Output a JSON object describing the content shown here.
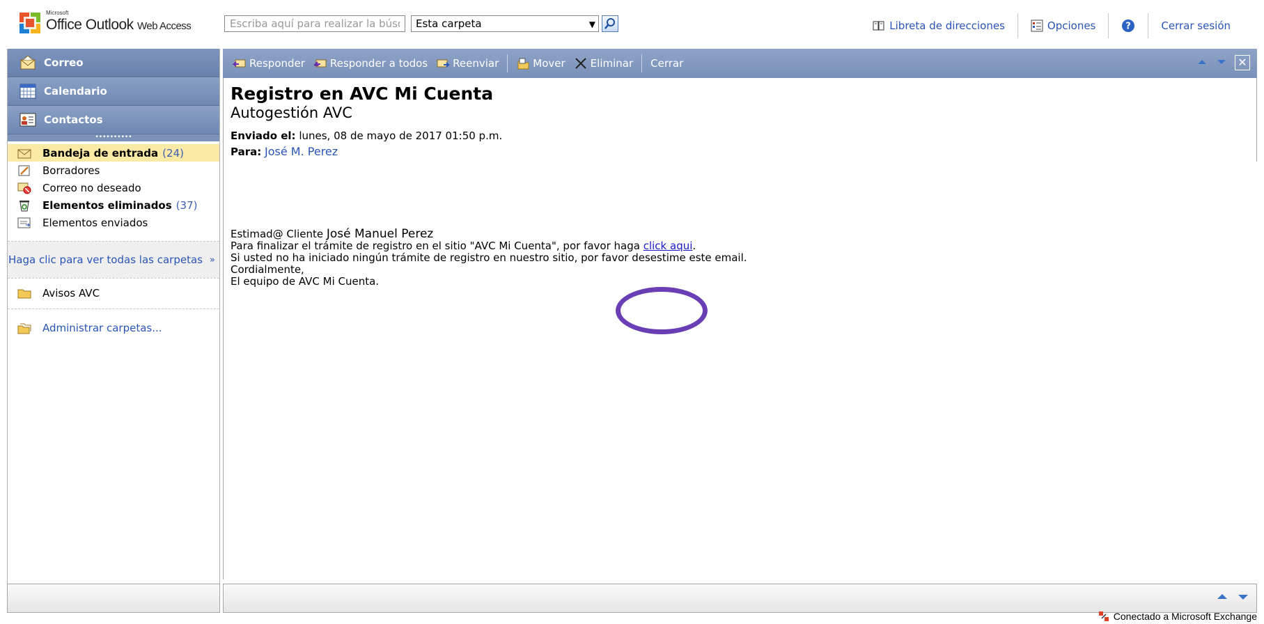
{
  "app": {
    "logo_vendor": "Microsoft",
    "logo_product": "Office Outlook",
    "logo_suffix": "Web Access"
  },
  "search": {
    "placeholder": "Escriba aquí para realizar la búsq",
    "scope": "Esta carpeta"
  },
  "top_links": {
    "address_book": "Libreta de direcciones",
    "options": "Opciones",
    "help_icon": "help-icon",
    "logout": "Cerrar sesión"
  },
  "nav": {
    "mail": "Correo",
    "calendar": "Calendario",
    "contacts": "Contactos"
  },
  "folders": [
    {
      "label": "Bandeja de entrada",
      "count": "(24)",
      "icon": "inbox-icon"
    },
    {
      "label": "Borradores",
      "count": "",
      "icon": "drafts-icon"
    },
    {
      "label": "Correo no deseado",
      "count": "",
      "icon": "junk-icon"
    },
    {
      "label": "Elementos eliminados",
      "count": "(37)",
      "icon": "deleted-icon"
    },
    {
      "label": "Elementos enviados",
      "count": "",
      "icon": "sent-icon"
    }
  ],
  "all_folders_link": "Haga clic para ver todas las carpetas",
  "custom_folder": "Avisos AVC",
  "manage_folders": "Administrar carpetas...",
  "toolbar": {
    "reply": "Responder",
    "reply_all": "Responder a todos",
    "forward": "Reenviar",
    "move": "Mover",
    "delete": "Eliminar",
    "close": "Cerrar"
  },
  "message": {
    "subject": "Registro en AVC Mi Cuenta",
    "from_display": "Autogestión AVC",
    "sent_label": "Enviado el:",
    "sent_value": "lunes, 08 de mayo de 2017 01:50 p.m.",
    "to_label": "Para:",
    "to_value": "José M. Perez",
    "greeting": "Estimad@ Cliente",
    "recipient_name": "José Manuel Perez",
    "line1_before": "Para finalizar el trámite de registro en el sitio \"AVC Mi Cuenta\", por favor haga ",
    "link_text": "click aqui",
    "line1_after": ".",
    "line2": "Si usted no ha iniciado ningún trámite de registro en nuestro sitio, por favor desestime este email.",
    "line3": "Cordialmente,",
    "line4": "El equipo de AVC Mi Cuenta."
  },
  "annotation_color": "#6a3fb5",
  "status": "Conectado a Microsoft Exchange"
}
